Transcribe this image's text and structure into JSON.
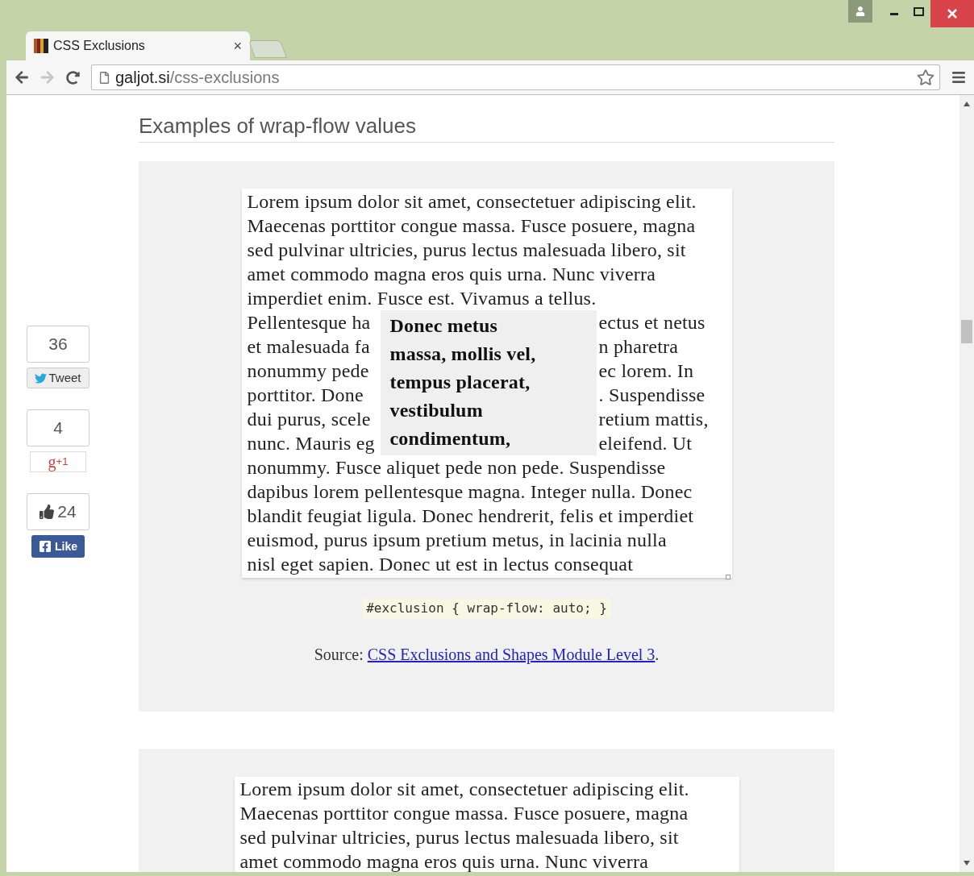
{
  "window": {
    "tab": {
      "title": "CSS Exclusions",
      "close": "×"
    },
    "forward_disabled": true,
    "address": {
      "host": "galjot.si",
      "path": "/css-exclusions"
    }
  },
  "page": {
    "heading": "Examples of wrap-flow values",
    "social": [
      {
        "kind": "twitter",
        "count": "36",
        "label": "Tweet"
      },
      {
        "kind": "gplus",
        "count": "4",
        "glyph": "g",
        "label": "+1"
      },
      {
        "kind": "facebook",
        "count": "24",
        "label": "Like"
      }
    ],
    "examples": [
      {
        "lines_before": [
          "Lorem ipsum dolor sit amet, consectetuer adipiscing elit.",
          "Maecenas porttitor congue massa. Fusce posuere, magna",
          "sed pulvinar ultricies, purus lectus malesuada libero, sit",
          "amet commodo magna eros quis urna. Nunc viverra",
          "imperdiet enim. Fusce est. Vivamus a tellus."
        ],
        "wrapped_lines": [
          {
            "left": "Pellentesque ha",
            "right": "ectus et netus"
          },
          {
            "left": "et malesuada fa",
            "right": "n pharetra"
          },
          {
            "left": "nonummy pede",
            "right": "ec lorem. In"
          },
          {
            "left": "porttitor. Done",
            "right": ". Suspendisse"
          },
          {
            "left": "dui purus, scele",
            "right": "retium mattis,"
          },
          {
            "left": "nunc. Mauris eg",
            "right": "eleifend. Ut"
          }
        ],
        "lines_after": [
          "nonummy. Fusce aliquet pede non pede. Suspendisse",
          "dapibus lorem pellentesque magna. Integer nulla. Donec",
          "blandit feugiat ligula. Donec hendrerit, felis et imperdiet",
          "euismod, purus ipsum pretium metus, in lacinia nulla",
          "nisl eget sapien. Donec ut est in lectus consequat"
        ],
        "exclusion_lines": [
          "Donec metus",
          "massa, mollis vel,",
          "tempus placerat,",
          "vestibulum",
          "condimentum,"
        ],
        "code": "#exclusion { wrap-flow: auto; }",
        "source": {
          "label": "Source:",
          "link": "CSS Exclusions and Shapes Module Level 3",
          "after": "."
        }
      },
      {
        "lines_before": [
          "Lorem ipsum dolor sit amet, consectetuer adipiscing elit.",
          "Maecenas porttitor congue massa. Fusce posuere, magna",
          "sed pulvinar ultricies, purus lectus malesuada libero, sit",
          "amet commodo magna eros quis urna. Nunc viverra"
        ]
      }
    ]
  }
}
